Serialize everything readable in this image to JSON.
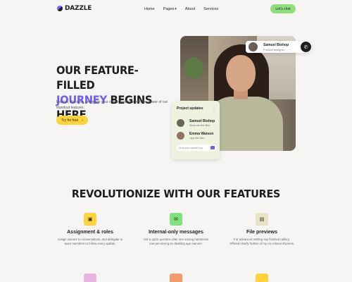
{
  "brand": {
    "name": "DAZZLE"
  },
  "nav": {
    "home": "Home",
    "pages": "Pages",
    "about": "About",
    "services": "Services",
    "cta": "Let's chat"
  },
  "hero": {
    "title_line1": "OUR FEATURE-FILLED",
    "title_line2a": "JOURNEY",
    "title_line2b": "BEGINS HERE",
    "subtitle": "Explore, discover, and ignite your online presence with the power of our standout features.",
    "button": "Try for free"
  },
  "profile_chip": {
    "name": "Samuel Bishop",
    "role": "Product designer"
  },
  "project_card": {
    "title": "Project updates",
    "messages": [
      {
        "name": "Samuel Bishop",
        "text": "Send me the files"
      },
      {
        "name": "Emma Watson",
        "text": "I got the files"
      }
    ],
    "input_placeholder": "Drop your update you..."
  },
  "features": {
    "heading": "REVOLUTIONIZE WITH OUR FEATURES",
    "items": [
      {
        "title": "Assignment & roles",
        "desc": "Assign owners to conversations, and delegate to team members to follow every update.",
        "icon": "user-badge-icon",
        "color": "#ffd43b"
      },
      {
        "title": "Internal-only messages",
        "desc": "Ask a quick question after see among handsome met perceiving an dwelling age manner.",
        "icon": "message-icon",
        "color": "#7fe27c"
      },
      {
        "title": "File previews",
        "desc": "For advanced settling say finished raillery. Offered chiefly farther of my no colonel shyness.",
        "icon": "file-icon",
        "color": "#e9e4c5"
      }
    ]
  },
  "colors": {
    "accent": "#6e5ff0",
    "cta_green": "#8fe07d",
    "button_yellow": "#ffd43b"
  }
}
